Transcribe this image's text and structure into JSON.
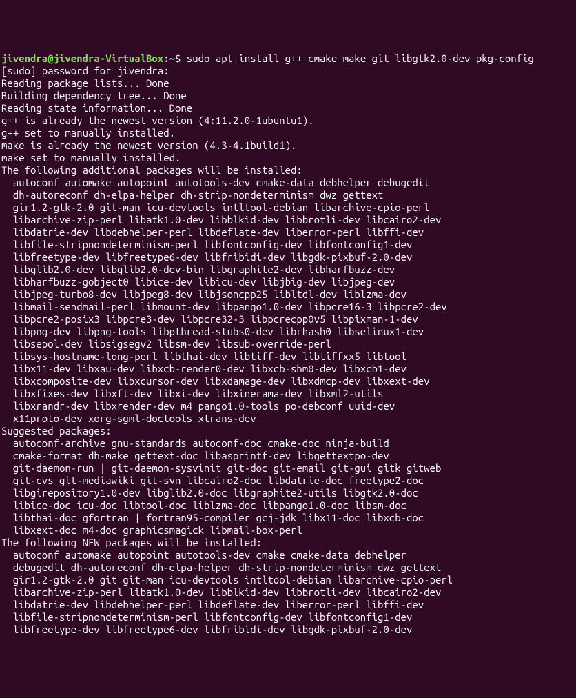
{
  "prompt": {
    "user_host": "jivendra@jivendra-VirtualBox",
    "separator": ":",
    "path": "~",
    "dollar": "$ ",
    "command": "sudo apt install g++ cmake make git libgtk2.0-dev pkg-config"
  },
  "lines": [
    "[sudo] password for jivendra:",
    "Reading package lists... Done",
    "Building dependency tree... Done",
    "Reading state information... Done",
    "g++ is already the newest version (4:11.2.0-1ubuntu1).",
    "g++ set to manually installed.",
    "make is already the newest version (4.3-4.1build1).",
    "make set to manually installed.",
    "The following additional packages will be installed:",
    "  autoconf automake autopoint autotools-dev cmake-data debhelper debugedit",
    "  dh-autoreconf dh-elpa-helper dh-strip-nondeterminism dwz gettext",
    "  gir1.2-gtk-2.0 git-man icu-devtools intltool-debian libarchive-cpio-perl",
    "  libarchive-zip-perl libatk1.0-dev libblkid-dev libbrotli-dev libcairo2-dev",
    "  libdatrie-dev libdebhelper-perl libdeflate-dev liberror-perl libffi-dev",
    "  libfile-stripnondeterminism-perl libfontconfig-dev libfontconfig1-dev",
    "  libfreetype-dev libfreetype6-dev libfribidi-dev libgdk-pixbuf-2.0-dev",
    "  libglib2.0-dev libglib2.0-dev-bin libgraphite2-dev libharfbuzz-dev",
    "  libharfbuzz-gobject0 libice-dev libicu-dev libjbig-dev libjpeg-dev",
    "  libjpeg-turbo8-dev libjpeg8-dev libjsoncpp25 libltdl-dev liblzma-dev",
    "  libmail-sendmail-perl libmount-dev libpango1.0-dev libpcre16-3 libpcre2-dev",
    "  libpcre2-posix3 libpcre3-dev libpcre32-3 libpcrecpp0v5 libpixman-1-dev",
    "  libpng-dev libpng-tools libpthread-stubs0-dev librhash0 libselinux1-dev",
    "  libsepol-dev libsigsegv2 libsm-dev libsub-override-perl",
    "  libsys-hostname-long-perl libthai-dev libtiff-dev libtiffxx5 libtool",
    "  libx11-dev libxau-dev libxcb-render0-dev libxcb-shm0-dev libxcb1-dev",
    "  libxcomposite-dev libxcursor-dev libxdamage-dev libxdmcp-dev libxext-dev",
    "  libxfixes-dev libxft-dev libxi-dev libxinerama-dev libxml2-utils",
    "  libxrandr-dev libxrender-dev m4 pango1.0-tools po-debconf uuid-dev",
    "  x11proto-dev xorg-sgml-doctools xtrans-dev",
    "Suggested packages:",
    "  autoconf-archive gnu-standards autoconf-doc cmake-doc ninja-build",
    "  cmake-format dh-make gettext-doc libasprintf-dev libgettextpo-dev",
    "  git-daemon-run | git-daemon-sysvinit git-doc git-email git-gui gitk gitweb",
    "  git-cvs git-mediawiki git-svn libcairo2-doc libdatrie-doc freetype2-doc",
    "  libgirepository1.0-dev libglib2.0-doc libgraphite2-utils libgtk2.0-doc",
    "  libice-doc icu-doc libtool-doc liblzma-doc libpango1.0-doc libsm-doc",
    "  libthai-doc gfortran | fortran95-compiler gcj-jdk libx11-doc libxcb-doc",
    "  libxext-doc m4-doc graphicsmagick libmail-box-perl",
    "The following NEW packages will be installed:",
    "  autoconf automake autopoint autotools-dev cmake cmake-data debhelper",
    "  debugedit dh-autoreconf dh-elpa-helper dh-strip-nondeterminism dwz gettext",
    "  gir1.2-gtk-2.0 git git-man icu-devtools intltool-debian libarchive-cpio-perl",
    "  libarchive-zip-perl libatk1.0-dev libblkid-dev libbrotli-dev libcairo2-dev",
    "  libdatrie-dev libdebhelper-perl libdeflate-dev liberror-perl libffi-dev",
    "  libfile-stripnondeterminism-perl libfontconfig-dev libfontconfig1-dev",
    "  libfreetype-dev libfreetype6-dev libfribidi-dev libgdk-pixbuf-2.0-dev"
  ]
}
